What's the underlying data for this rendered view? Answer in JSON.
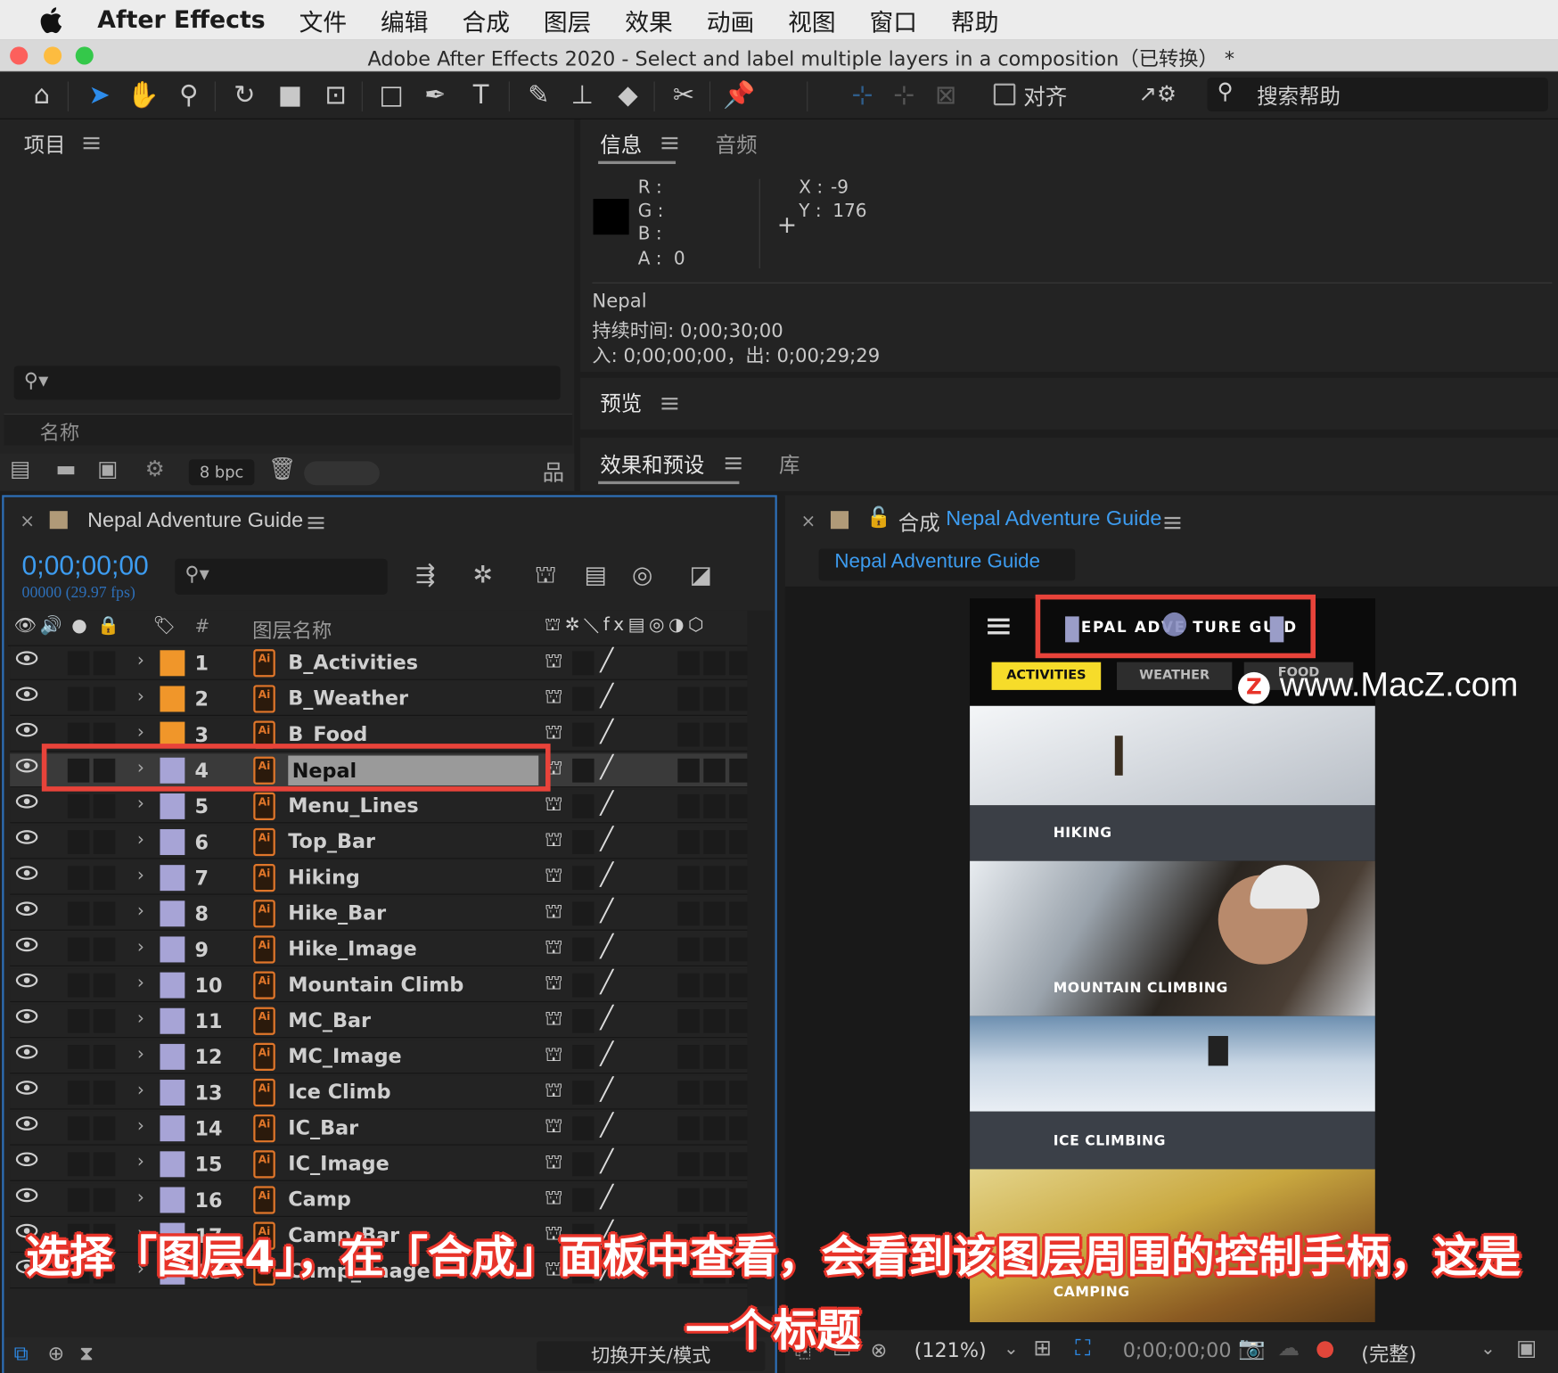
{
  "menubar": {
    "app": "After Effects",
    "items": [
      "文件",
      "编辑",
      "合成",
      "图层",
      "效果",
      "动画",
      "视图",
      "窗口",
      "帮助"
    ]
  },
  "window": {
    "title": "Adobe After Effects 2020 - Select and label multiple layers in a composition（已转换） *"
  },
  "toolbar": {
    "align_label": "对齐",
    "search_placeholder": "搜索帮助",
    "tools": [
      "home-icon",
      "selection-tool-icon",
      "hand-tool-icon",
      "zoom-tool-icon",
      "rotate-tool-icon",
      "camera-tool-icon",
      "pan-behind-icon",
      "rectangle-tool-icon",
      "pen-tool-icon",
      "type-tool-icon",
      "brush-tool-icon",
      "clone-stamp-icon",
      "eraser-tool-icon",
      "roto-brush-icon",
      "puppet-pin-icon"
    ]
  },
  "project_panel": {
    "title": "项目",
    "column_name": "名称",
    "bpc": "8 bpc"
  },
  "info_panel": {
    "tabs": [
      "信息",
      "音频"
    ],
    "r_label": "R :",
    "g_label": "G :",
    "b_label": "B :",
    "a_label": "A :",
    "a_value": "0",
    "x_label": "X :",
    "x_value": "-9",
    "y_label": "Y :",
    "y_value": "176",
    "layer_name": "Nepal",
    "duration": "持续时间: 0;00;30;00",
    "in_out": "入: 0;00;00;00，出: 0;00;29;29"
  },
  "preview_panel": {
    "title": "预览"
  },
  "effects_panel": {
    "tabs": [
      "效果和预设",
      "库"
    ]
  },
  "timeline": {
    "comp_name": "Nepal Adventure Guide",
    "timecode": "0;00;00;00",
    "frames": "00000 (29.97 fps)",
    "col_num": "#",
    "col_layer_name": "图层名称",
    "toggle_label": "切换开关/模式",
    "layers": [
      {
        "num": "1",
        "name": "B_Activities",
        "color": "#f0962a"
      },
      {
        "num": "2",
        "name": "B_Weather",
        "color": "#f0962a"
      },
      {
        "num": "3",
        "name": "B_Food",
        "color": "#f0962a"
      },
      {
        "num": "4",
        "name": "Nepal",
        "color": "#a7a4d6"
      },
      {
        "num": "5",
        "name": "Menu_Lines",
        "color": "#a7a4d6"
      },
      {
        "num": "6",
        "name": "Top_Bar",
        "color": "#a7a4d6"
      },
      {
        "num": "7",
        "name": "Hiking",
        "color": "#a7a4d6"
      },
      {
        "num": "8",
        "name": "Hike_Bar",
        "color": "#a7a4d6"
      },
      {
        "num": "9",
        "name": "Hike_Image",
        "color": "#a7a4d6"
      },
      {
        "num": "10",
        "name": "Mountain Climb",
        "color": "#a7a4d6"
      },
      {
        "num": "11",
        "name": "MC_Bar",
        "color": "#a7a4d6"
      },
      {
        "num": "12",
        "name": "MC_Image",
        "color": "#a7a4d6"
      },
      {
        "num": "13",
        "name": "Ice Climb",
        "color": "#a7a4d6"
      },
      {
        "num": "14",
        "name": "IC_Bar",
        "color": "#a7a4d6"
      },
      {
        "num": "15",
        "name": "IC_Image",
        "color": "#a7a4d6"
      },
      {
        "num": "16",
        "name": "Camp",
        "color": "#a7a4d6"
      },
      {
        "num": "17",
        "name": "Camp_Bar",
        "color": "#a7a4d6"
      },
      {
        "num": "18",
        "name": "Camp_Image",
        "color": "#a7a4d6"
      }
    ],
    "selected_layer": "4"
  },
  "composition": {
    "prefix": "合成",
    "name": "Nepal Adventure Guide",
    "breadcrumb": "Nepal Adventure Guide",
    "zoom": "(121%)",
    "timecode": "0;00;00;00",
    "quality": "(完整)",
    "app_preview": {
      "header_title": "EPAL ADVE  TURE GUID",
      "tabs": [
        "ACTIVITIES",
        "WEATHER",
        "FOOD"
      ],
      "sections": [
        "HIKING",
        "MOUNTAIN CLIMBING",
        "ICE CLIMBING",
        "CAMPING"
      ]
    }
  },
  "watermark": {
    "logo_letter": "Z",
    "text": "www.MacZ.com"
  },
  "caption": {
    "line1": "选择「图层4」，在「合成」面板中查看，会看到该图层周围的控制手柄，这是",
    "line2": "一个标题"
  },
  "colors": {
    "accent": "#2d8ceb",
    "highlight": "#e8433a",
    "activities_tab": "#f6dc2a"
  }
}
